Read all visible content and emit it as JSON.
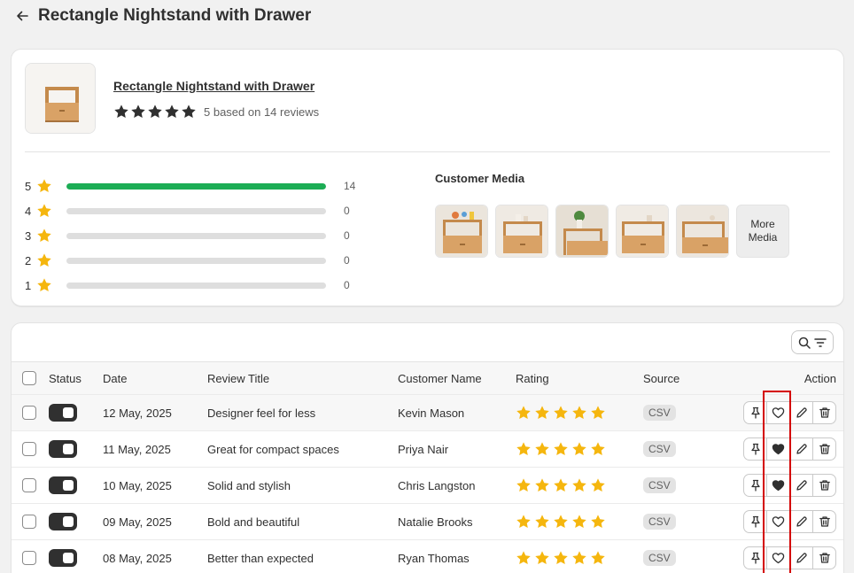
{
  "page": {
    "title": "Rectangle Nightstand with Drawer"
  },
  "product": {
    "name": "Rectangle Nightstand with Drawer",
    "rating_summary": "5 based on 14 reviews",
    "average_rating": 5
  },
  "distribution": [
    {
      "stars": "5",
      "count": "14",
      "fraction": 1.0
    },
    {
      "stars": "4",
      "count": "0",
      "fraction": 0
    },
    {
      "stars": "3",
      "count": "0",
      "fraction": 0
    },
    {
      "stars": "2",
      "count": "0",
      "fraction": 0
    },
    {
      "stars": "1",
      "count": "0",
      "fraction": 0
    }
  ],
  "media": {
    "title": "Customer Media",
    "more_label_1": "More",
    "more_label_2": "Media"
  },
  "table": {
    "headers": {
      "status": "Status",
      "date": "Date",
      "title": "Review Title",
      "customer": "Customer Name",
      "rating": "Rating",
      "source": "Source",
      "action": "Action"
    },
    "rows": [
      {
        "date": "12 May, 2025",
        "title": "Designer feel for less",
        "customer": "Kevin Mason",
        "rating": 5,
        "source": "CSV",
        "favorited": false
      },
      {
        "date": "11 May, 2025",
        "title": "Great for compact spaces",
        "customer": "Priya Nair",
        "rating": 5,
        "source": "CSV",
        "favorited": true
      },
      {
        "date": "10 May, 2025",
        "title": "Solid and stylish",
        "customer": "Chris Langston",
        "rating": 5,
        "source": "CSV",
        "favorited": true
      },
      {
        "date": "09 May, 2025",
        "title": "Bold and beautiful",
        "customer": "Natalie Brooks",
        "rating": 5,
        "source": "CSV",
        "favorited": false
      },
      {
        "date": "08 May, 2025",
        "title": "Better than expected",
        "customer": "Ryan Thomas",
        "rating": 5,
        "source": "CSV",
        "favorited": false
      }
    ]
  },
  "colors": {
    "star": "#f5b60e",
    "bar_fill": "#1cad55",
    "bar_track": "#dedede",
    "highlight": "#d40000"
  },
  "icons": {
    "back": "arrow-left-icon",
    "star": "star-icon",
    "search": "search-icon",
    "filter": "filter-icon",
    "pin": "pin-icon",
    "heart": "heart-icon",
    "edit": "pencil-icon",
    "delete": "trash-icon"
  }
}
